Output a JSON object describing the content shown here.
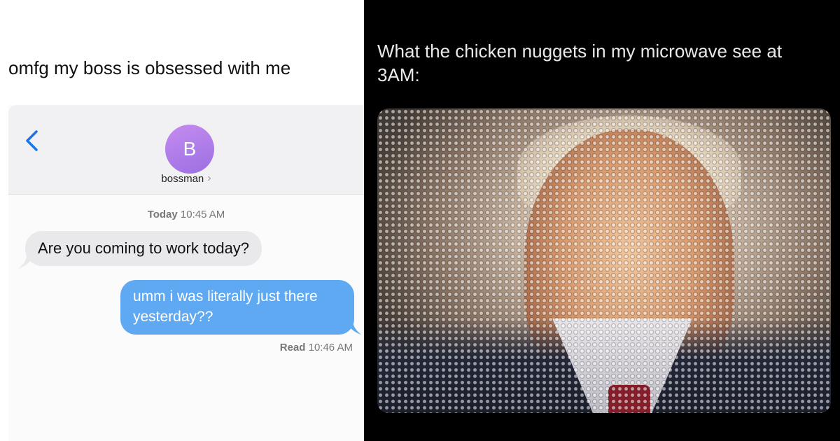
{
  "left_panel": {
    "caption": "omfg my boss is obsessed with me",
    "conversation": {
      "avatar_initial": "B",
      "contact_name": "bossman",
      "contact_chevron": "›",
      "timestamp_day": "Today",
      "timestamp_time": "10:45 AM",
      "incoming_message": "Are you coming to work today?",
      "outgoing_message": "umm i was literally just there yesterday??",
      "read_label": "Read",
      "read_time": "10:46 AM"
    },
    "colors": {
      "outgoing_bubble": "#5ea9f2",
      "incoming_bubble": "#e9e9eb",
      "back_chevron": "#1a73e8",
      "avatar": "#b07eea"
    },
    "icons": {
      "back": "chevron-left-icon"
    }
  },
  "right_panel": {
    "caption": "What the chicken nuggets in my microwave see at 3AM:",
    "photo": "man in suit viewed through microwave mesh"
  }
}
